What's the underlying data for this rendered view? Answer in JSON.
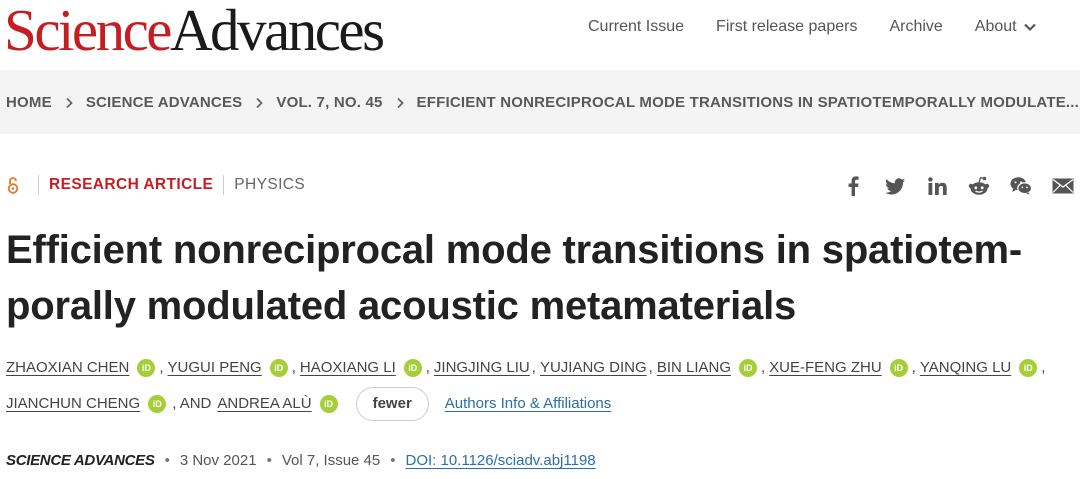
{
  "header": {
    "logo_part1": "Science",
    "logo_part2": "Advances",
    "nav": [
      "Current Issue",
      "First release papers",
      "Archive",
      "About"
    ]
  },
  "breadcrumb": {
    "items": [
      "HOME",
      "SCIENCE ADVANCES",
      "VOL. 7, NO. 45",
      "EFFICIENT NONRECIPROCAL MODE TRANSITIONS IN SPATIOTEMPORALLY MODULATE..."
    ]
  },
  "article": {
    "type": "RESEARCH ARTICLE",
    "subject": "PHYSICS",
    "title_line1": "Efficient nonreciprocal mode transitions in spatiotem-",
    "title_line2": "porally modulated acoustic metamaterials",
    "share_icons": [
      "facebook-icon",
      "twitter-icon",
      "linkedin-icon",
      "reddit-icon",
      "wechat-icon",
      "email-icon"
    ]
  },
  "authors": {
    "names": [
      "ZHAOXIAN CHEN",
      "YUGUI PENG",
      "HAOXIANG LI",
      "JINGJING LIU",
      "YUJIANG DING",
      "BIN LIANG",
      "XUE-FENG ZHU",
      "YANQING LU",
      "JIANCHUN CHENG",
      "ANDREA ALÙ"
    ],
    "and_text": ", AND",
    "fewer_label": "fewer",
    "affiliations_label": "Authors Info & Affiliations",
    "orcid_label": "iD"
  },
  "citation": {
    "journal": "SCIENCE ADVANCES",
    "date": "3 Nov 2021",
    "volume": "Vol 7, Issue 45",
    "doi": "DOI: 10.1126/sciadv.abj1198"
  },
  "colors": {
    "brand_red": "#c41e24",
    "link_blue": "#2b6ea8",
    "orcid_green": "#a6ce39",
    "breadcrumb_bg": "#f4f4f4"
  }
}
